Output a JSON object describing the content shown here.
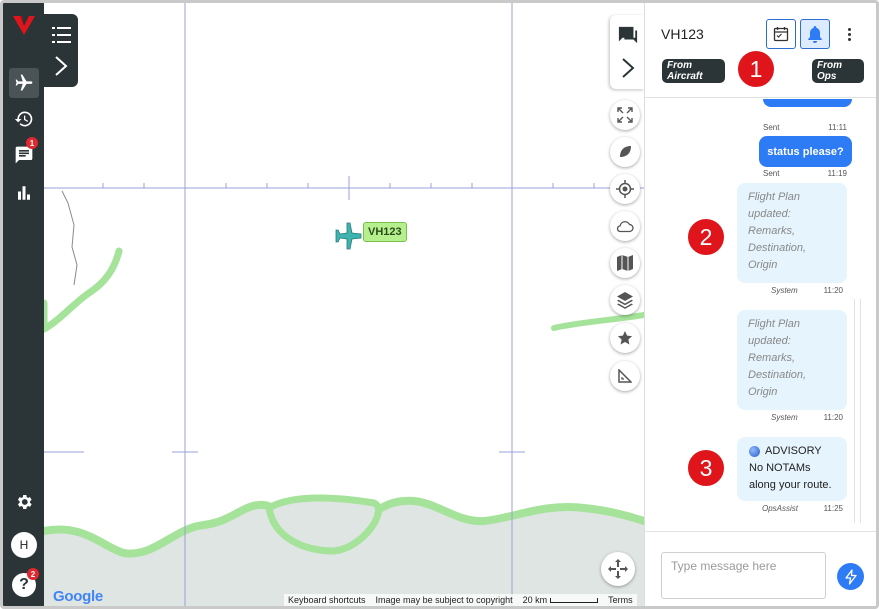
{
  "left_nav": {
    "items": [
      {
        "name": "logo",
        "icon": "brand-v-logo"
      },
      {
        "name": "flights",
        "icon": "airplane-icon",
        "active": true
      },
      {
        "name": "history",
        "icon": "history-icon"
      },
      {
        "name": "messages",
        "icon": "chat-icon",
        "badge": "1"
      },
      {
        "name": "reports",
        "icon": "bar-chart-icon"
      },
      {
        "name": "settings",
        "icon": "gear-icon"
      },
      {
        "name": "user",
        "icon": "avatar",
        "label": "H"
      },
      {
        "name": "help",
        "icon": "help-icon",
        "badge": "2"
      }
    ]
  },
  "map": {
    "aircraft_label": "VH123",
    "attribution": {
      "keyboard": "Keyboard shortcuts",
      "imagery": "Image may be subject to copyright",
      "scale": "20 km",
      "terms": "Terms"
    },
    "logo_text": "Google",
    "controls": [
      "fullscreen-icon",
      "leaf-icon",
      "locate-icon",
      "cloud-icon",
      "map-icon",
      "layers-icon",
      "star-icon",
      "ruler-icon"
    ],
    "colors": {
      "land": "#ffffff",
      "water": "#dfe5e2",
      "coast": "#a6e39a",
      "grid": "#9aa0d8",
      "label_bg": "#b6f08e"
    }
  },
  "panel": {
    "title": "VH123",
    "filters": {
      "from_aircraft": "From Aircraft",
      "from_ops": "From Ops"
    },
    "messages": [
      {
        "direction": "out",
        "text": "",
        "status": "Sent",
        "time": "11:11"
      },
      {
        "direction": "out",
        "text": "status please?",
        "status": "Sent",
        "time": "11:19"
      },
      {
        "direction": "in",
        "lines": [
          "Flight Plan",
          "updated:",
          "Remarks,",
          "Destination,",
          "Origin"
        ],
        "sender": "System",
        "time": "11:20"
      },
      {
        "direction": "in",
        "lines": [
          "Flight Plan",
          "updated:",
          "Remarks,",
          "Destination,",
          "Origin"
        ],
        "sender": "System",
        "time": "11:20"
      },
      {
        "direction": "in",
        "advisory_title": "ADVISORY",
        "lines": [
          "No NOTAMs",
          "along your route."
        ],
        "sender": "OpsAssist",
        "time": "11:25"
      }
    ],
    "composer": {
      "placeholder": "Type message here"
    }
  },
  "callouts": [
    "1",
    "2",
    "3"
  ],
  "colors": {
    "accent": "#2e7bf6",
    "nav": "#2b3436",
    "callout": "#e0151b",
    "bubble_in": "#e6f4fd"
  }
}
